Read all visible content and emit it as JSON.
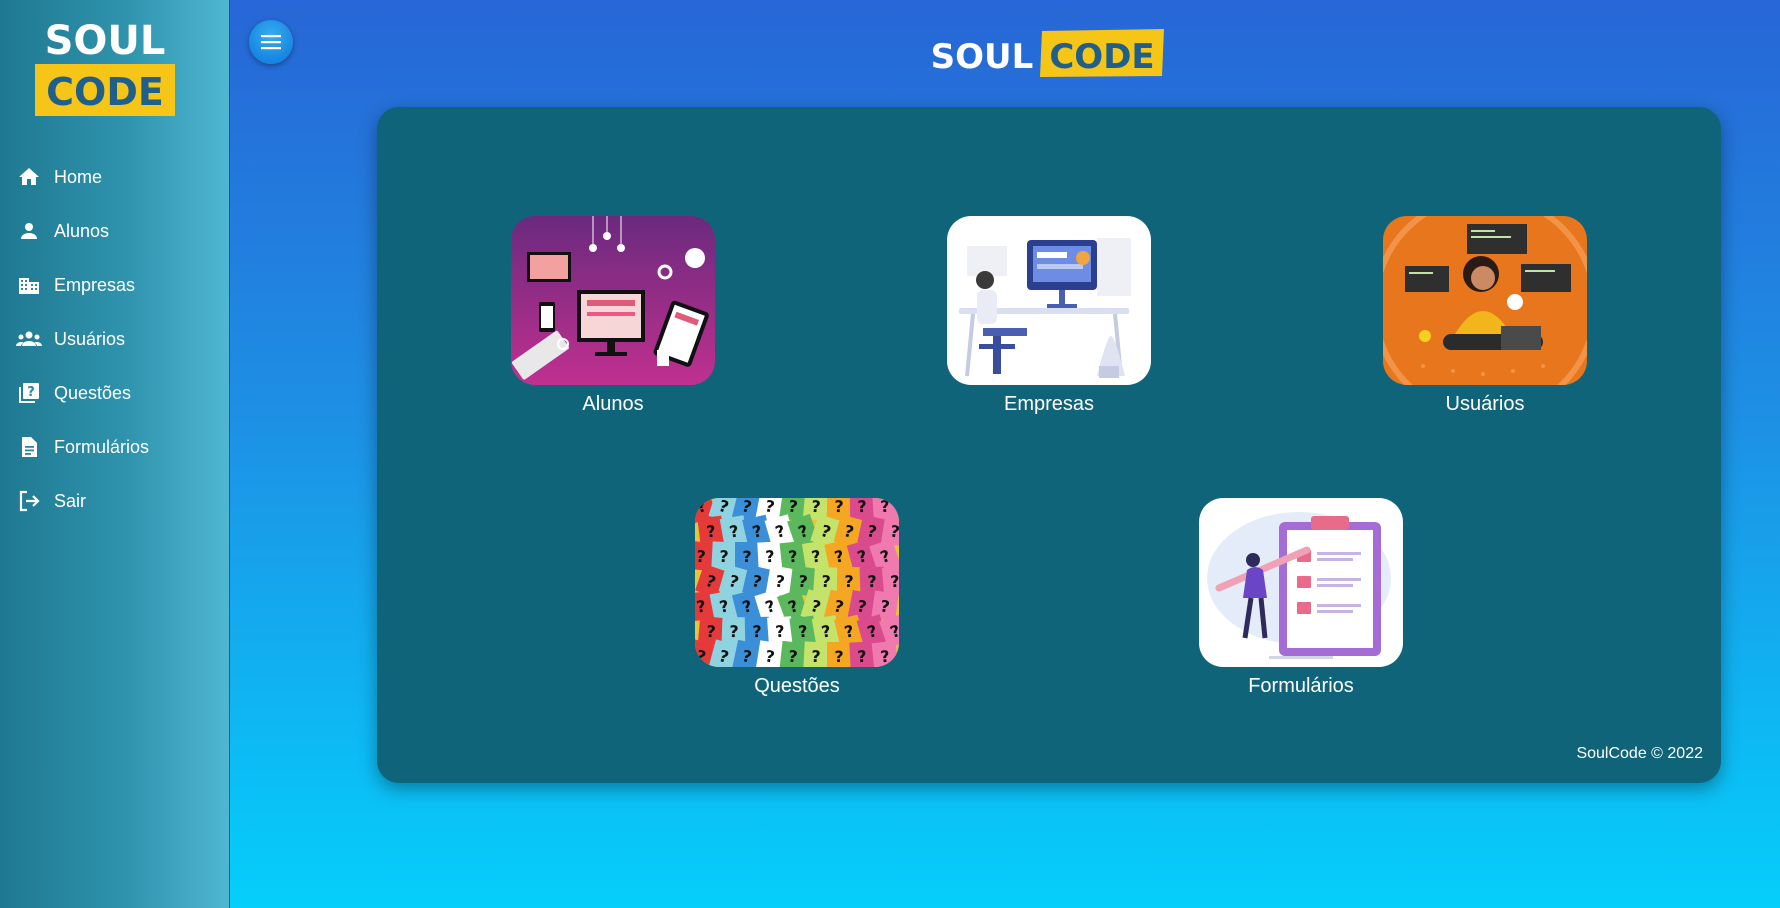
{
  "brand": {
    "word1": "SOUL",
    "word2": "CODE",
    "accent": "#f5c518"
  },
  "sidebar": {
    "items": [
      {
        "label": "Home",
        "icon": "home-icon"
      },
      {
        "label": "Alunos",
        "icon": "person-icon"
      },
      {
        "label": "Empresas",
        "icon": "building-icon"
      },
      {
        "label": "Usuários",
        "icon": "group-icon"
      },
      {
        "label": "Questões",
        "icon": "question-book-icon"
      },
      {
        "label": "Formulários",
        "icon": "document-icon"
      },
      {
        "label": "Sair",
        "icon": "logout-icon"
      }
    ]
  },
  "header": {
    "menu_icon": "menu-icon"
  },
  "cards": [
    {
      "label": "Alunos"
    },
    {
      "label": "Empresas"
    },
    {
      "label": "Usuários"
    },
    {
      "label": "Questões"
    },
    {
      "label": "Formulários"
    }
  ],
  "footer": {
    "text": "SoulCode © 2022"
  },
  "colors": {
    "panel": "#10647a",
    "background_top": "#2766d6",
    "background_bottom": "#05cffb"
  }
}
